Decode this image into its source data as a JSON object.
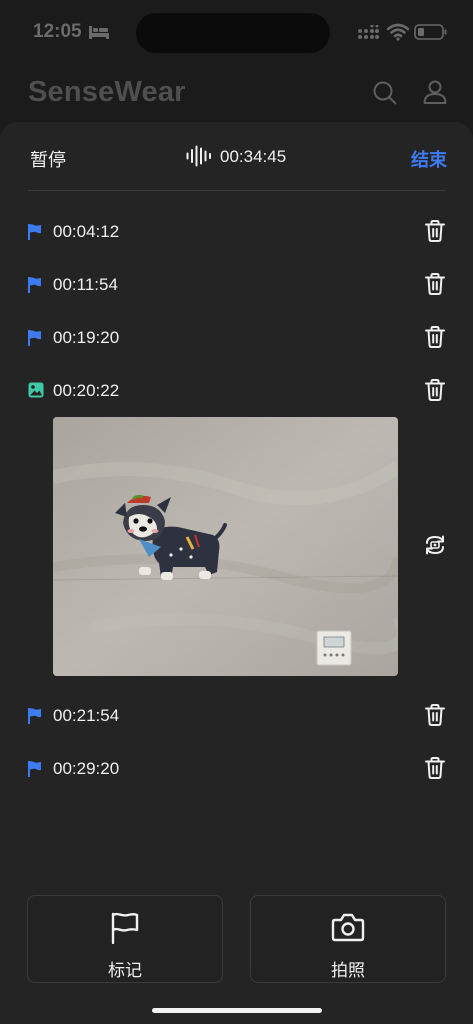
{
  "status_bar": {
    "time": "12:05"
  },
  "header": {
    "app_title": "SenseWear"
  },
  "recording": {
    "pause_label": "暂停",
    "timer": "00:34:45",
    "end_label": "结束"
  },
  "entries": [
    {
      "type": "flag",
      "time": "00:04:12"
    },
    {
      "type": "flag",
      "time": "00:11:54"
    },
    {
      "type": "flag",
      "time": "00:19:20"
    },
    {
      "type": "photo",
      "time": "00:20:22"
    },
    {
      "type": "flag",
      "time": "00:21:54"
    },
    {
      "type": "flag",
      "time": "00:29:20"
    }
  ],
  "actions": {
    "mark_label": "标记",
    "photo_label": "拍照"
  },
  "colors": {
    "accent": "#3d7bf0",
    "photo_icon": "#3ec9a7",
    "background": "#1b1b1b",
    "sheet": "#242424"
  },
  "icons": [
    "bed-icon",
    "signal-icon",
    "wifi-icon",
    "battery-icon",
    "search-icon",
    "user-icon",
    "waveform-icon",
    "flag-icon",
    "image-icon",
    "trash-icon",
    "rotate-icon",
    "camera-icon"
  ]
}
